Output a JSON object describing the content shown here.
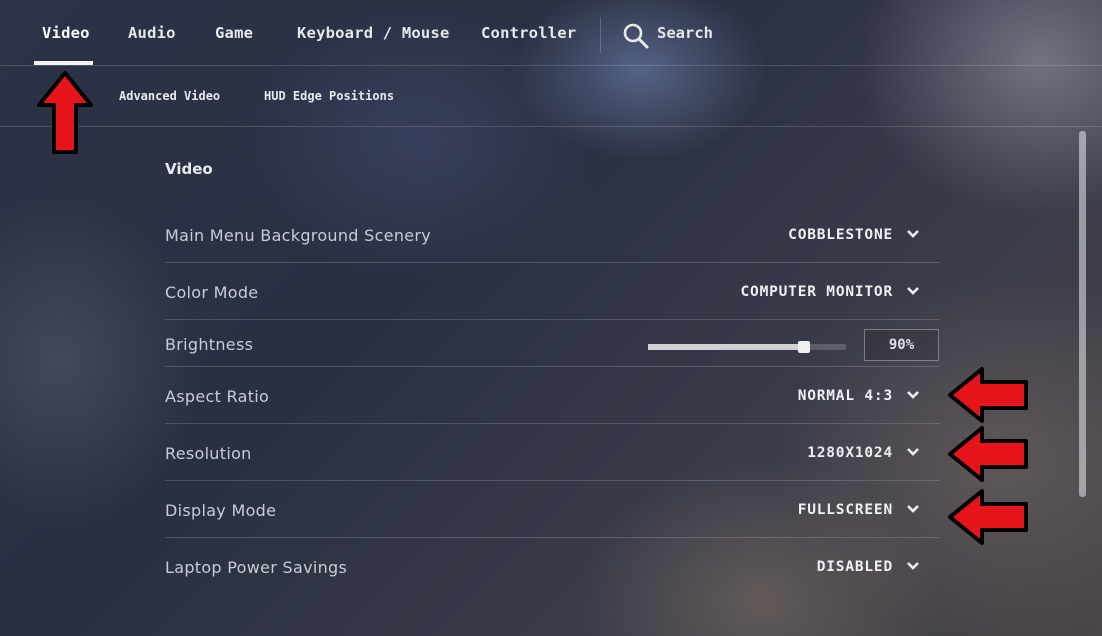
{
  "top_nav": {
    "tabs": [
      {
        "label": "Video",
        "active": true
      },
      {
        "label": "Audio"
      },
      {
        "label": "Game"
      },
      {
        "label": "Keyboard / Mouse"
      },
      {
        "label": "Controller"
      }
    ],
    "search": {
      "label": "Search",
      "icon": "search-icon"
    }
  },
  "sub_nav": {
    "tabs": [
      {
        "label": "Advanced Video"
      },
      {
        "label": "HUD Edge Positions"
      }
    ]
  },
  "section": {
    "title": "Video",
    "rows": [
      {
        "label": "Main Menu Background Scenery",
        "value": "COBBLESTONE"
      },
      {
        "label": "Color Mode",
        "value": "COMPUTER MONITOR"
      },
      {
        "label": "Brightness",
        "value": "90%",
        "slider_level": 0.79
      },
      {
        "label": "Aspect Ratio",
        "value": "NORMAL 4:3"
      },
      {
        "label": "Resolution",
        "value": "1280X1024"
      },
      {
        "label": "Display Mode",
        "value": "FULLSCREEN"
      },
      {
        "label": "Laptop Power Savings",
        "value": "DISABLED"
      }
    ]
  },
  "colors": {
    "annotation_arrow": "#e8141b",
    "text": "#dfe2e8",
    "accent": "#f2f2f2"
  }
}
